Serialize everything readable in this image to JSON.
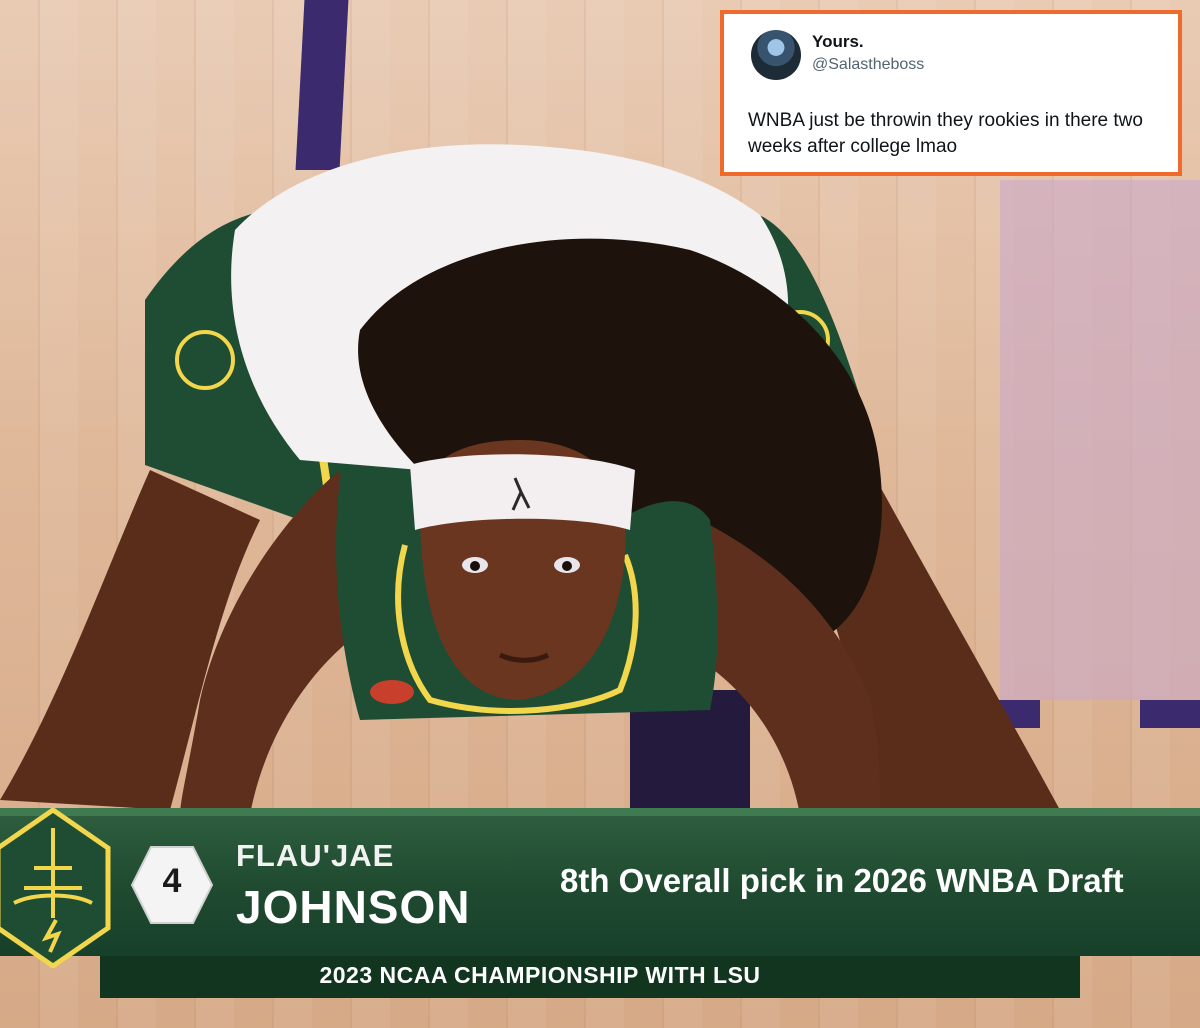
{
  "tweet": {
    "display_name": "Yours.",
    "handle": "@Salastheboss",
    "text": "WNBA just be throwin they rookies in there two weeks after college lmao",
    "border_color": "#ee6b2d"
  },
  "lower_third": {
    "pick_number": "4",
    "first_name": "FLAU'JAE",
    "last_name": "JOHNSON",
    "draft_text": "8th Overall pick in 2026 WNBA Draft",
    "subtitle": "2023 NCAA CHAMPIONSHIP WITH LSU",
    "bar_color": "#1f4a30",
    "accent_color": "#f2d64b"
  },
  "colors": {
    "jersey_green": "#1e4d33",
    "trim_yellow": "#f2d64b",
    "headband": "#f3eef0"
  },
  "icons": {
    "team_logo": "seattle-storm-logo-icon",
    "headband_logo": "wnba-logo-icon"
  }
}
